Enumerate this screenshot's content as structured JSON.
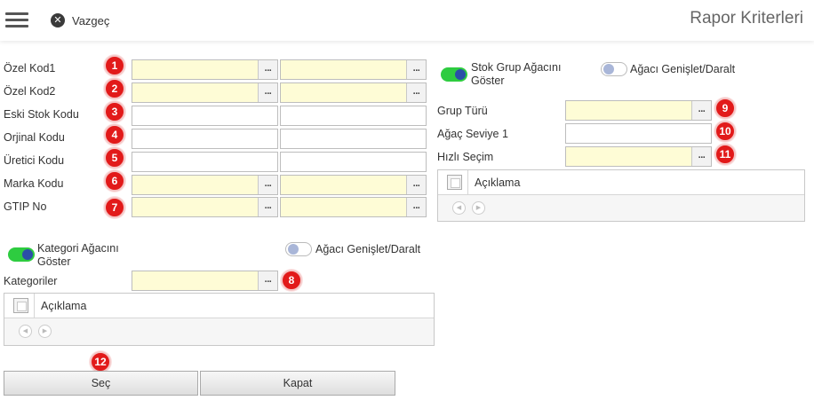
{
  "header": {
    "cancel_label": "Vazgeç",
    "title": "Rapor Kriterleri",
    "icons": {
      "menu": "hamburger-menu-icon",
      "cancel": "close-circle-icon"
    }
  },
  "left_form": {
    "rows": [
      {
        "label": "Özel Kod1",
        "badge": "1",
        "color": "yellow"
      },
      {
        "label": "Özel Kod2",
        "badge": "2",
        "color": "yellow"
      },
      {
        "label": "Eski Stok Kodu",
        "badge": "3",
        "color": "white"
      },
      {
        "label": "Orjinal Kodu",
        "badge": "4",
        "color": "white"
      },
      {
        "label": "Üretici Kodu",
        "badge": "5",
        "color": "white"
      },
      {
        "label": "Marka Kodu",
        "badge": "6",
        "color": "yellow"
      },
      {
        "label": "GTIP No",
        "badge": "7",
        "color": "yellow"
      }
    ],
    "ellipsis": "..."
  },
  "kategori": {
    "toggle_label": "Kategori Ağacını Göster",
    "expand_label": "Ağacı Genişlet/Daralt",
    "field_label": "Kategoriler",
    "badge": "8",
    "grid_column": "Açıklama"
  },
  "stok_grup": {
    "toggle_label": "Stok Grup Ağacını Göster",
    "expand_label": "Ağacı Genişlet/Daralt",
    "rows": [
      {
        "label": "Grup Türü",
        "badge": "9"
      },
      {
        "label": "Ağaç Seviye 1",
        "badge": "10"
      },
      {
        "label": "Hızlı Seçim",
        "badge": "11"
      }
    ],
    "grid_column": "Açıklama"
  },
  "actions": {
    "select_label": "Seç",
    "close_label": "Kapat",
    "badge": "12"
  },
  "colors": {
    "field_yellow": "#fefcd6",
    "badge_red": "#e21a1a",
    "toggle_on": "#2ecc40",
    "toggle_knob": "#2b4fa8"
  }
}
